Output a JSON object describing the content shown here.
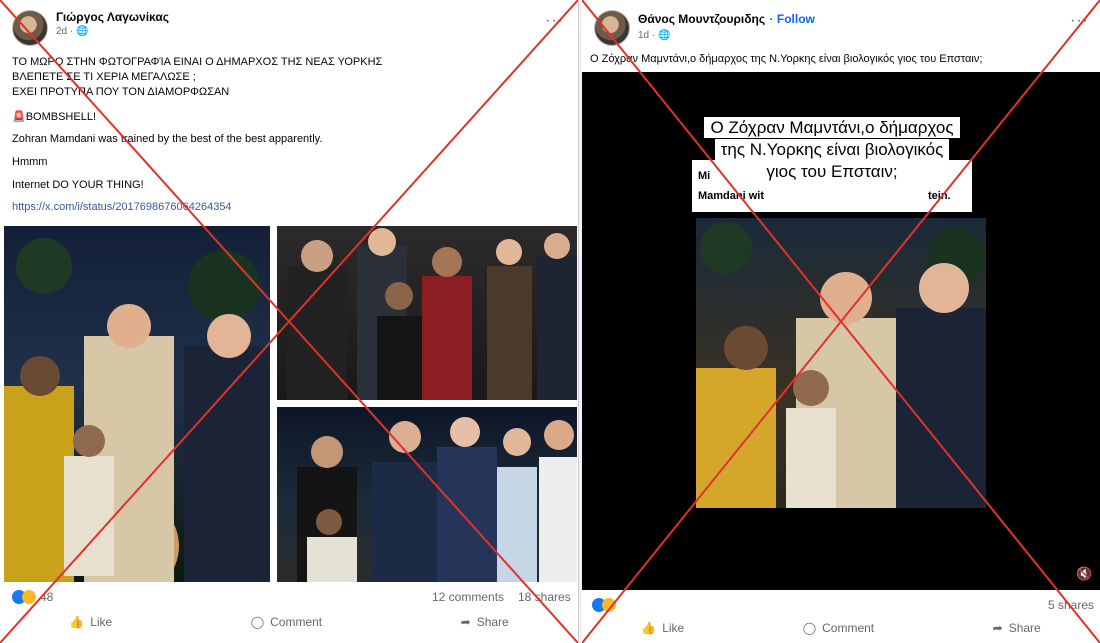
{
  "left": {
    "author": "Γιώργος Λαγωνίκας",
    "meta": "2d · 🌐",
    "more": "···",
    "lines": [
      "ΤΟ ΜΩΡΟ ΣΤΗΝ ΦΩΤΟΓΡΑΦΊΑ ΕΙΝΑΙ Ο ΔΗΜΑΡΧΟΣ ΤΗΣ ΝΕΑΣ ΥΟΡΚΗΣ",
      "ΒΛΕΠΕΤΕ ΣΕ ΤΙ ΧΕΡΙΑ ΜΕΓΑΛΩΣΕ ;",
      "ΕΧΕΙ ΠΡΟΤΥΠΑ ΠΟΥ ΤΟΝ ΔΙΑΜΟΡΦΩΣΑΝ",
      "🚨BOMBSHELL!",
      "Zohran Mamdani was trained by the best of the best apparently.",
      "Hmmm",
      "Internet DO YOUR THING!"
    ],
    "link": "https://x.com/i/status/2017698676064264354",
    "reactions_count": "48",
    "comments": "12 comments",
    "shares": "18 shares",
    "like": "Like",
    "comment": "Comment",
    "share": "Share"
  },
  "right": {
    "author": "Θάνος Μουντζουριδης",
    "follow": "· Follow",
    "meta": "1d · 🌐",
    "more": "···",
    "text": "Ο Ζόχραν Μαμντάνι,ο δήμαρχος της Ν.Υορκης  είναι βιολογικός γιος του Επσταιν;",
    "video_title": "Ο Ζόχραν Μαμντάνι,ο δήμαρχος της Ν.Υορκης είναι βιολογικός γιος του Επσταιν;",
    "caption_line1": "Mi",
    "caption_line2": "Mamdani wit",
    "caption_tail": "tein.",
    "shares": "5 shares",
    "like": "Like",
    "comment": "Comment",
    "share": "Share"
  },
  "colors": {
    "cross": "#e0322a",
    "like_blue": "#1877f2",
    "link": "#385898"
  }
}
